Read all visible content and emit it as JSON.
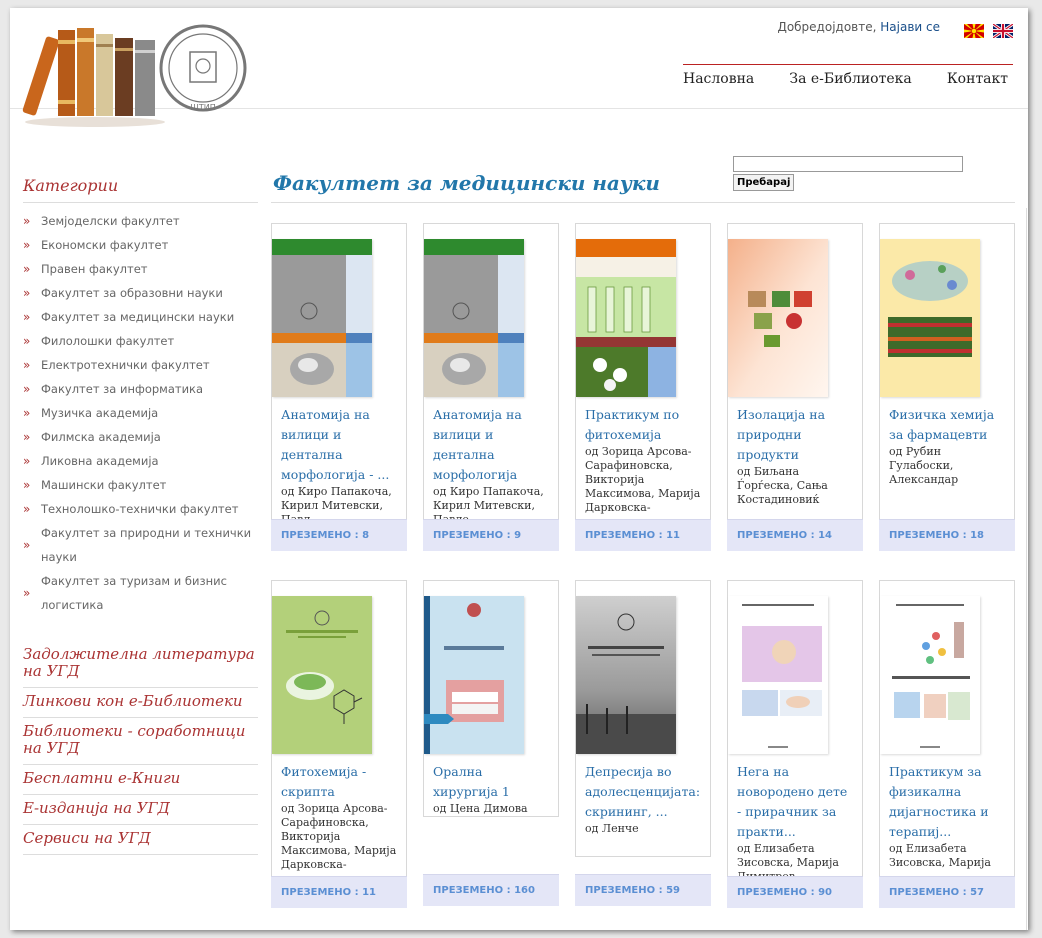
{
  "header": {
    "welcome_text": "Добредојдовте,",
    "login_link": "Најави се",
    "flags": [
      "mk-flag",
      "uk-flag"
    ],
    "nav": [
      "Насловна",
      "За е-Библиотека",
      "Контакт"
    ]
  },
  "search": {
    "button_label": "Пребарај",
    "value": ""
  },
  "sidebar": {
    "categories_title": "Категории",
    "categories": [
      "Земјоделски факултет",
      "Економски факултет",
      "Правен факултет",
      "Факултет за образовни науки",
      "Факултет за медицински науки",
      "Филолошки факултет",
      "Електротехнички факултет",
      "Факултет за информатика",
      "Музичка академија",
      "Филмска академија",
      "Ликовна академија",
      "Машински факултет",
      "Технолошко-технички факултет",
      "Факултет за природни и технички науки",
      "Факултет за туризам и бизнис логистика"
    ],
    "links": [
      "Задолжителна литература на УГД",
      "Линкови кон е-Библиотеки",
      "Библиотеки - соработници на УГД",
      "Бесплатни е-Книги",
      "Е-изданија на УГД",
      "Сервиси на УГД"
    ]
  },
  "main": {
    "title": "Факултет за медицински науки",
    "download_label": "ПРЕЗЕМЕНО",
    "books": [
      {
        "title": "Анатомија на вилици и дентална морфологија - ...",
        "authors": "од Киро Папакоча, Кирил Митевски, Павл...",
        "downloads": "8"
      },
      {
        "title": "Анатомија на вилици и дентална морфологија",
        "authors": "од Киро Папакоча, Кирил Митевски, Павле Апостолоски, Михајло Петровски",
        "downloads": "9"
      },
      {
        "title": "Практикум по фитохемија",
        "authors": "од Зорица Арсова-Сарафиновска, Викторија Максимова, Марија Дарковска-Серафимовска",
        "downloads": "11"
      },
      {
        "title": "Изолација на природни продукти",
        "authors": "од Биљана Ѓорѓеска, Сања Костадиновиќ Величковска",
        "downloads": "14"
      },
      {
        "title": "Физичка хемија за фармацевти",
        "authors": "од Рубин Гулабоски, Александар Цветковски",
        "downloads": "18"
      },
      {
        "title": "Фитохемија - скрипта",
        "authors": "од Зорица Арсова-Сарафиновска, Викторија Максимова, Марија Дарковска-Серафимовска",
        "downloads": "11"
      },
      {
        "title": "Орална хирургија 1",
        "authors": "од Цена Димова",
        "downloads": "160"
      },
      {
        "title": "Депресија во адолесценцијата: скрининг, ...",
        "authors": "од Ленче Милошева",
        "downloads": "59"
      },
      {
        "title": "Нега на новородено дете - прирачник за практи...",
        "authors": "од Елизабета Зисовска, Марија Димитров...",
        "downloads": "90"
      },
      {
        "title": "Практикум за физикална дијагностика и терапиј...",
        "authors": "од Елизабета Зисовска, Марија Димитров...",
        "downloads": "57"
      }
    ]
  }
}
